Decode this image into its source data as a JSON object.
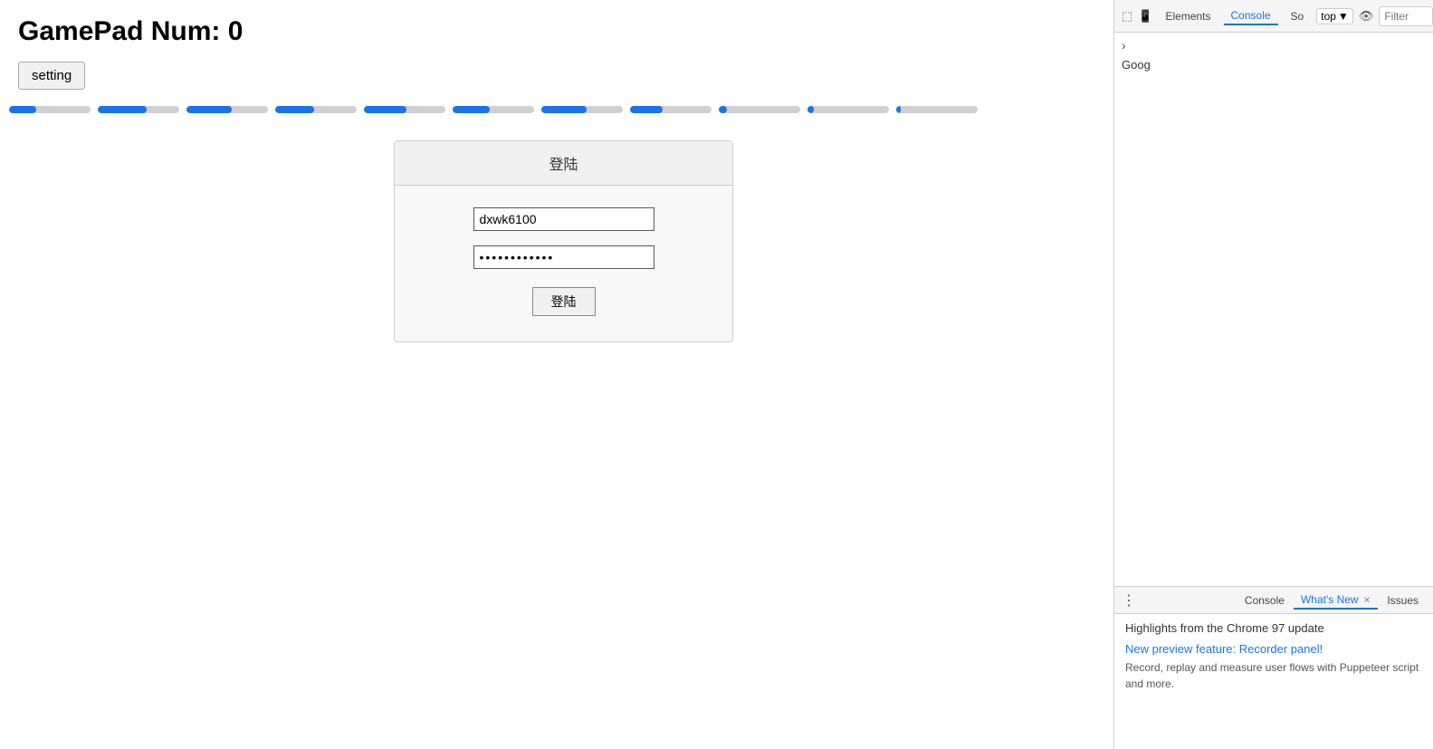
{
  "page": {
    "title": "GamePad Num: 0",
    "setting_button": "setting"
  },
  "sliders": [
    {
      "fill_pct": 33
    },
    {
      "fill_pct": 60
    },
    {
      "fill_pct": 55
    },
    {
      "fill_pct": 48
    },
    {
      "fill_pct": 52
    },
    {
      "fill_pct": 46
    },
    {
      "fill_pct": 55
    },
    {
      "fill_pct": 40
    },
    {
      "fill_pct": 10
    },
    {
      "fill_pct": 8
    },
    {
      "fill_pct": 6
    }
  ],
  "login": {
    "title": "登陆",
    "username_value": "dxwk6100",
    "password_value": "••••••••••••",
    "submit_label": "登陆"
  },
  "devtools": {
    "toolbar": {
      "tabs": [
        "Elements",
        "Console",
        "So"
      ],
      "top_label": "top",
      "filter_placeholder": "Filter"
    },
    "goog_text": "Goog",
    "chevron": "›",
    "bottom": {
      "dots": "⋮",
      "tabs": [
        "Console",
        "What's New",
        "Issues"
      ],
      "active_tab": "What's New",
      "highlight_text": "Highlights from the Chrome 97 update",
      "feature_title": "New preview feature: Recorder panel!",
      "feature_desc": "Record, replay and measure user flows with Puppeteer script and more."
    }
  }
}
